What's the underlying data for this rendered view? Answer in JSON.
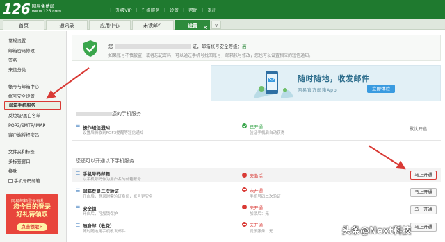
{
  "header": {
    "logo_number": "126",
    "logo_title": "网易免费邮",
    "logo_url": "www.126.com",
    "nav": [
      "升级VIP",
      "升级服务",
      "设置",
      "帮助",
      "退出"
    ]
  },
  "tabs": {
    "home": "首页",
    "contacts": "通讯录",
    "apps": "应用中心",
    "unread": "未读邮件",
    "settings": "设置",
    "close": "×",
    "more": "∨"
  },
  "sidebar": {
    "items": [
      "常规设置",
      "邮箱密码修改",
      "签名",
      "来信分类",
      "帐号与邮箱中心",
      "帐号安全设置",
      "邮箱手机服务",
      "反垃圾/黑白名单",
      "POP3/SMTP/IMAP",
      "客户端授权密码",
      "文件夹和标签",
      "多标签窗口",
      "换肤",
      "手机号码邮箱"
    ],
    "promo": {
      "line1": "网易邮箱登录有礼",
      "line2a": "您今日的登录",
      "line2b": "好礼待领取",
      "button": "点击领取>"
    }
  },
  "security": {
    "line1_prefix": "您",
    "line1_suffix": "证，邮箱帐号安全等级：",
    "level": "高",
    "line2": "如果账号不慎被盗，或者忘记密码，可以通过手机号找回账号，邮箱帐号修改，您也可以设置相应的短信通知。"
  },
  "banner": {
    "title": "随时随地，收发邮件",
    "subtitle": "网易官方邮箱App",
    "button": "立即体验"
  },
  "section_opened": {
    "title": "您的手机服务",
    "rows": [
      {
        "name": "操作短信通知",
        "desc": "设置后将收到POP3提醒等短信通知",
        "status": "已开通",
        "sub": "验证手机后自动获得",
        "right": "默认开启"
      }
    ]
  },
  "section_available": {
    "title": "您还可以开通以下手机服务",
    "rows": [
      {
        "name": "手机号码邮箱",
        "desc": "以手机号码作为用户名的邮箱账号",
        "status": "未激活",
        "sub": "",
        "button": "马上开通"
      },
      {
        "name": "邮箱登录二次验证",
        "desc": "开启后，登录时需验证身份，帐号更安全",
        "status": "未开通",
        "sub": "手机号码二次验证",
        "button": "马上开通"
      },
      {
        "name": "安全锁",
        "desc": "开启后，可加锁保护",
        "status": "未开通",
        "sub": "加锁后：无",
        "button": "马上开通"
      },
      {
        "name": "随身邮（收费）",
        "desc": "随时随地用手机收发邮件",
        "status": "未开通",
        "sub": "提示服务：无",
        "button": "马上开通"
      }
    ]
  },
  "watermark": "头条@Next科技",
  "colors": {
    "brand_green": "#1f7a2f",
    "tab_active": "#2e8b3c",
    "highlight_red": "#d93a35",
    "status_on": "#3aa64c",
    "banner_button": "#3a9be0"
  },
  "icons": [
    "shield-check-icon",
    "phone-icon",
    "check-icon",
    "minus-icon"
  ]
}
